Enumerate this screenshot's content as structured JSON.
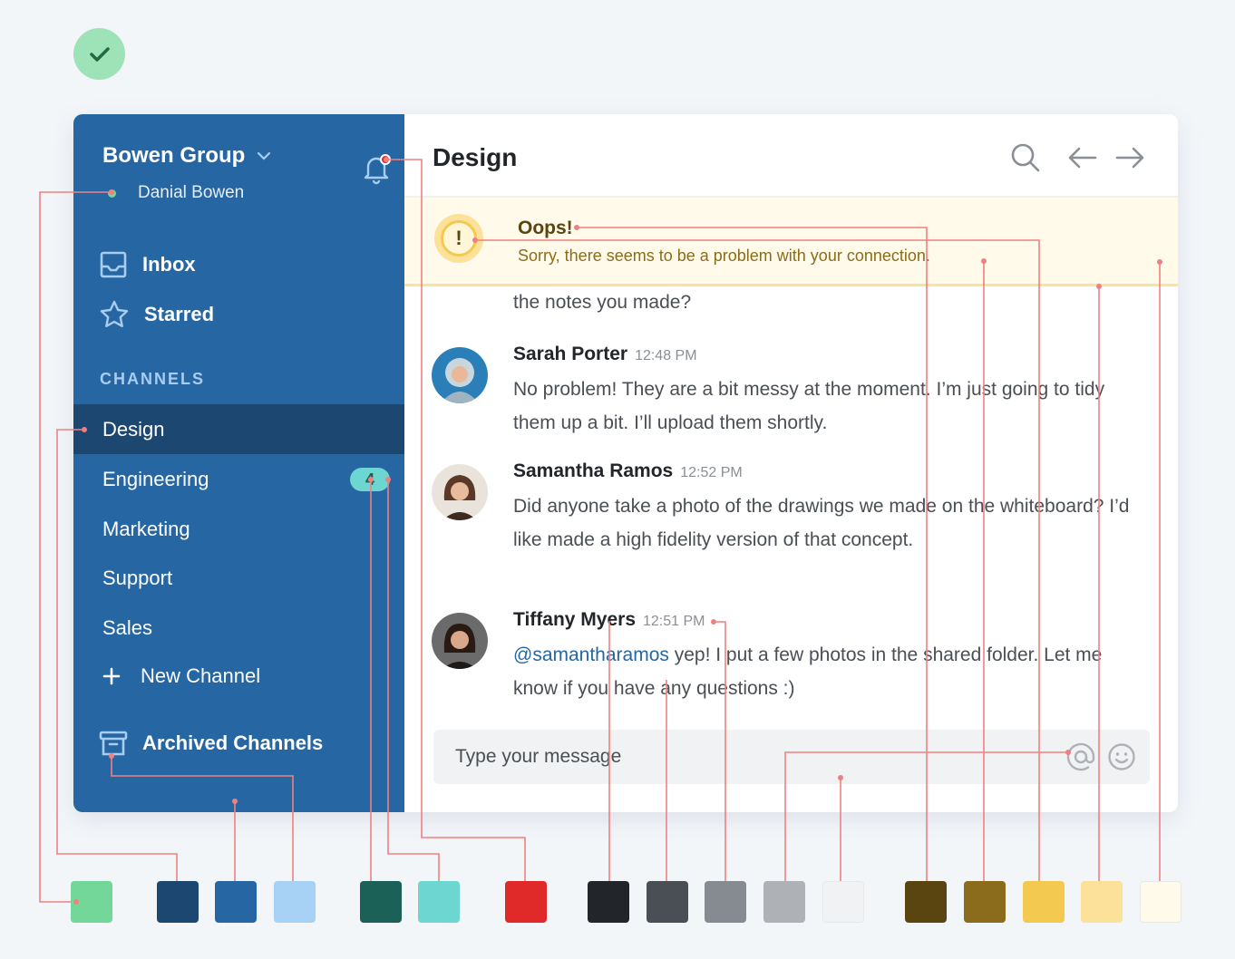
{
  "sidebar": {
    "workspace_name": "Bowen Group",
    "user_name": "Danial Bowen",
    "nav": [
      {
        "label": "Inbox",
        "icon": "inbox-icon"
      },
      {
        "label": "Starred",
        "icon": "star-icon"
      }
    ],
    "channels_title": "CHANNELS",
    "channels": [
      {
        "label": "Design",
        "active": true
      },
      {
        "label": "Engineering",
        "badge": "4"
      },
      {
        "label": "Marketing"
      },
      {
        "label": "Support"
      },
      {
        "label": "Sales"
      }
    ],
    "new_channel_label": "New Channel",
    "archived_label": "Archived Channels"
  },
  "main": {
    "channel_title": "Design",
    "alert": {
      "title": "Oops!",
      "text": "Sorry, there seems to be a problem with your connection."
    },
    "partial_message": "the notes you made?",
    "messages": [
      {
        "author": "Sarah Porter",
        "time": "12:48 PM",
        "body": "No problem! They are a bit messy at the moment. I’m just going to tidy them up a bit. I’ll upload them shortly."
      },
      {
        "author": "Samantha Ramos",
        "time": "12:52 PM",
        "body": "Did anyone take a photo of the drawings we made on the whiteboard? I’d like made a high fidelity version of that concept."
      },
      {
        "author": "Tiffany Myers",
        "time": "12:51 PM",
        "mention": "@samantharamos",
        "body": " yep! I put a few photos in the shared folder. Let me know if you have any questions :)"
      }
    ],
    "composer_placeholder": "Type your message"
  },
  "palette": [
    "#73d79a",
    "#1b4770",
    "#2566a3",
    "#a8d2f5",
    "#1b6157",
    "#6ed6d0",
    "#e02a2a",
    "#222529",
    "#4a4f55",
    "#868b91",
    "#aeb2b7",
    "#f1f2f3",
    "#5a4510",
    "#8a6c1c",
    "#f4c94f",
    "#fbe19a",
    "#fffaea"
  ],
  "colors": {
    "sidebar_bg": "#2566a3",
    "sidebar_active": "#1b4770",
    "accent_teal": "#6ed6d0",
    "notification_red": "#e02a2a",
    "alert_bg": "#fffaea",
    "online_green": "#73d79a"
  }
}
